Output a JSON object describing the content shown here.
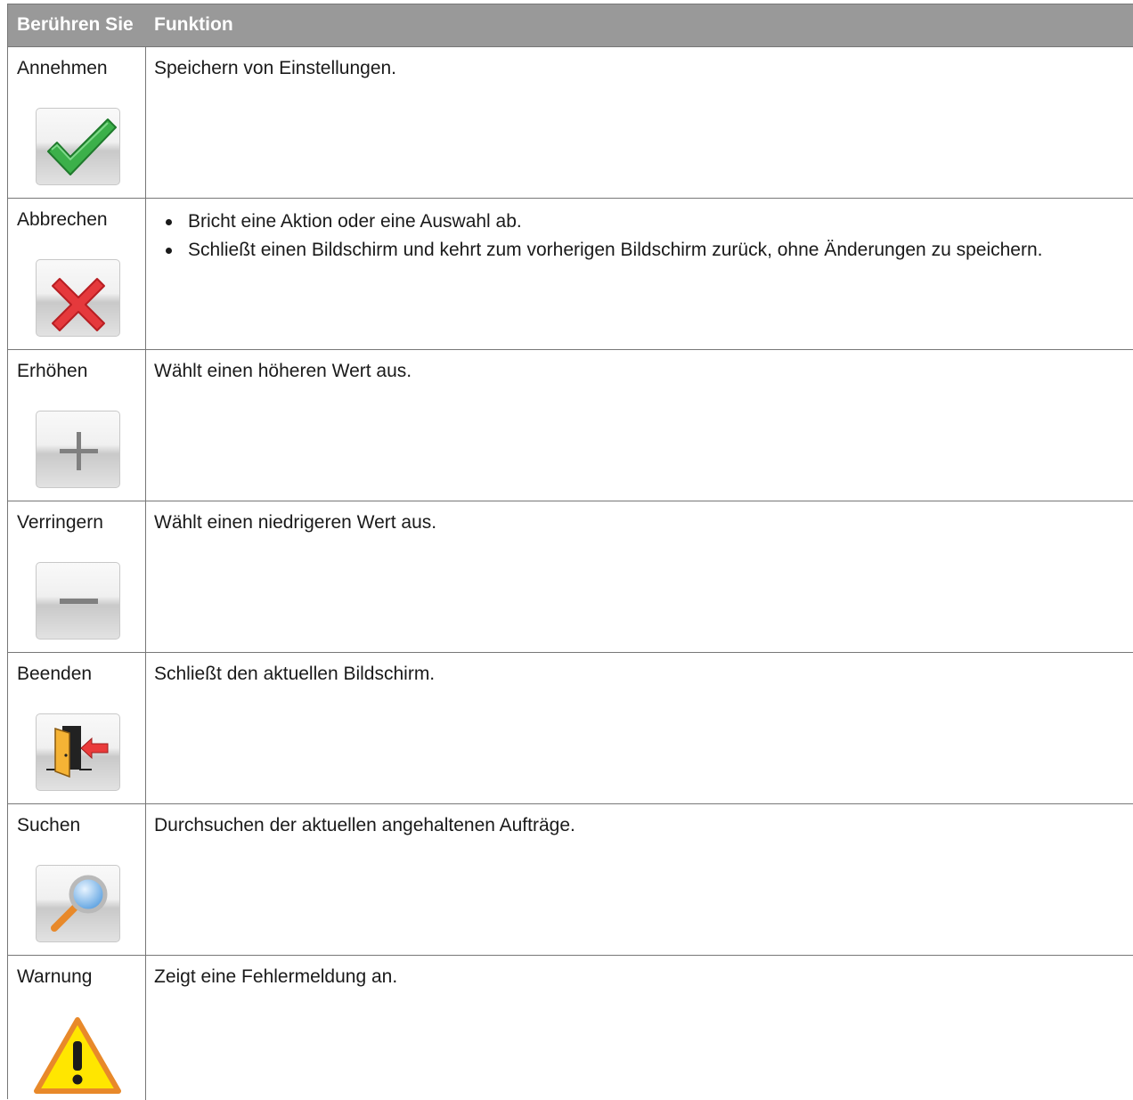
{
  "table": {
    "headers": [
      "Berühren Sie",
      "Funktion"
    ],
    "rows": [
      {
        "label": "Annehmen",
        "icon": "checkmark-icon",
        "description": "Speichern von Einstellungen."
      },
      {
        "label": "Abbrechen",
        "icon": "cancel-x-icon",
        "bullets": [
          "Bricht eine Aktion oder eine Auswahl ab.",
          "Schließt einen Bildschirm und kehrt zum vorherigen Bildschirm zurück, ohne Änderungen zu speichern."
        ]
      },
      {
        "label": "Erhöhen",
        "icon": "plus-icon",
        "description": "Wählt einen höheren Wert aus."
      },
      {
        "label": "Verringern",
        "icon": "minus-icon",
        "description": "Wählt einen niedrigeren Wert aus."
      },
      {
        "label": "Beenden",
        "icon": "exit-door-icon",
        "description": "Schließt den aktuellen Bildschirm."
      },
      {
        "label": "Suchen",
        "icon": "magnifier-icon",
        "description": "Durchsuchen der aktuellen angehaltenen Aufträge."
      },
      {
        "label": "Warnung",
        "icon": "warning-icon",
        "description": "Zeigt eine Fehlermeldung an."
      }
    ]
  },
  "colors": {
    "header_bg": "#999999",
    "check": "#3cb04a",
    "cancel": "#e5393c",
    "warning": "#ffe600"
  }
}
